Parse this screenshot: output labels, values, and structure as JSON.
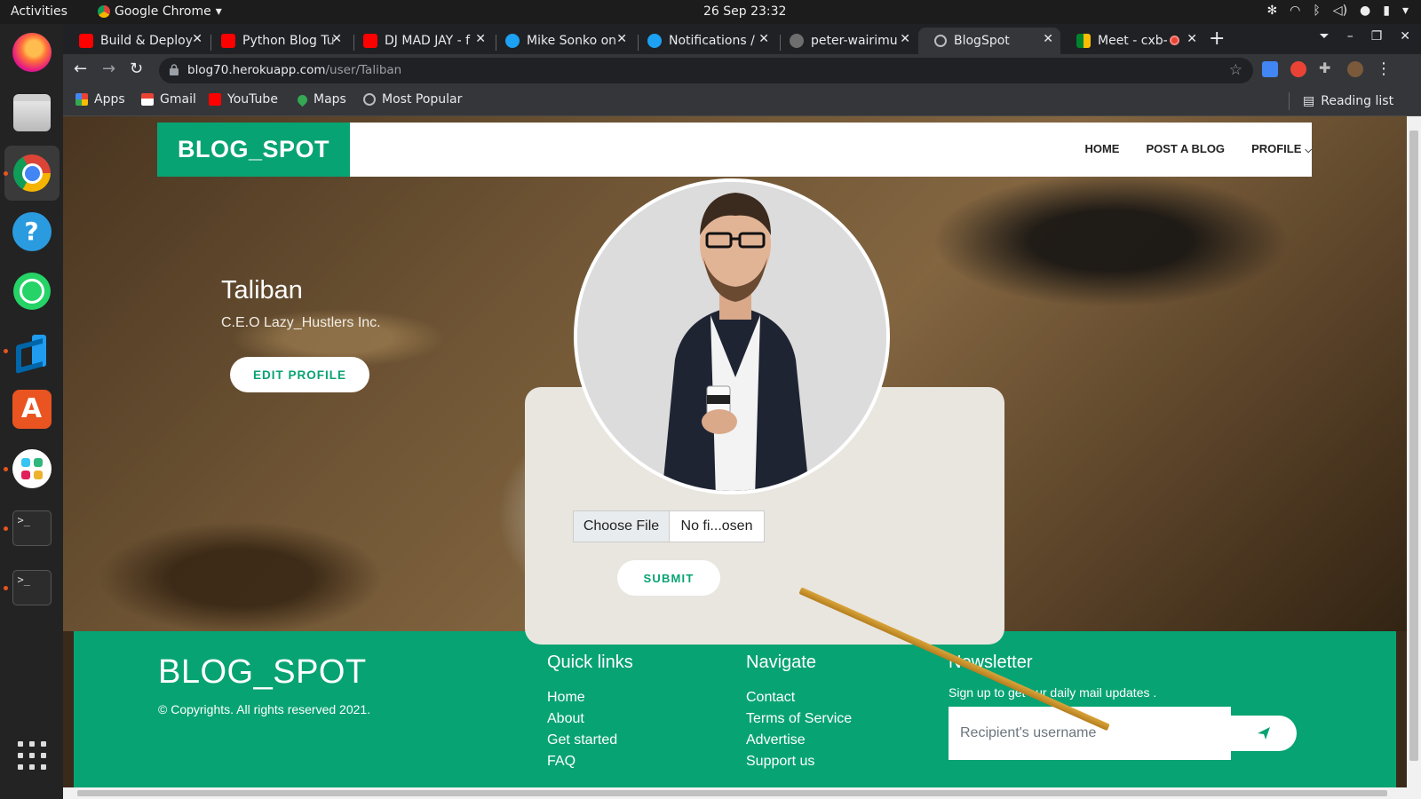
{
  "desktop": {
    "activities": "Activities",
    "app_name": "Google Chrome",
    "clock": "26 Sep  23:32"
  },
  "browser": {
    "tabs": [
      {
        "title": "Build & Deploy",
        "favicon": "youtube-icon"
      },
      {
        "title": "Python Blog Tu",
        "favicon": "youtube-icon"
      },
      {
        "title": "DJ MAD JAY - f",
        "favicon": "youtube-icon"
      },
      {
        "title": "Mike Sonko on",
        "favicon": "twitter-icon"
      },
      {
        "title": "Notifications /",
        "favicon": "twitter-icon"
      },
      {
        "title": "peter-wairimu",
        "favicon": "github-icon"
      },
      {
        "title": "BlogSpot",
        "favicon": "globe-icon",
        "active": true
      },
      {
        "title": "Meet - cxb-",
        "favicon": "meet-icon"
      }
    ],
    "url_host": "blog70.herokuapp.com",
    "url_path": "/user/Taliban",
    "bookmarks": [
      "Apps",
      "Gmail",
      "YouTube",
      "Maps",
      "Most Popular"
    ],
    "reading_list": "Reading list"
  },
  "page": {
    "brand": "BLOG_SPOT",
    "nav": {
      "home": "HOME",
      "post": "POST A BLOG",
      "profile": "PROFILE"
    },
    "profile": {
      "name": "Taliban",
      "role": "C.E.O Lazy_Hustlers Inc.",
      "edit_label": "EDIT PROFILE"
    },
    "upload": {
      "choose_label": "Choose File",
      "file_name": "No fi...osen",
      "submit_label": "SUBMIT"
    },
    "footer": {
      "brand": "BLOG_SPOT",
      "copyright": "© Copyrights. All rights reserved 2021.",
      "quick_links": {
        "heading": "Quick links",
        "items": [
          "Home",
          "About",
          "Get started",
          "FAQ"
        ]
      },
      "navigate": {
        "heading": "Navigate",
        "items": [
          "Contact",
          "Terms of Service",
          "Advertise",
          "Support us"
        ]
      },
      "newsletter": {
        "heading": "Newsletter",
        "subtitle": "Sign up to get our daily mail updates .",
        "placeholder": "Recipient's username"
      }
    },
    "colors": {
      "accent": "#08a373"
    }
  }
}
